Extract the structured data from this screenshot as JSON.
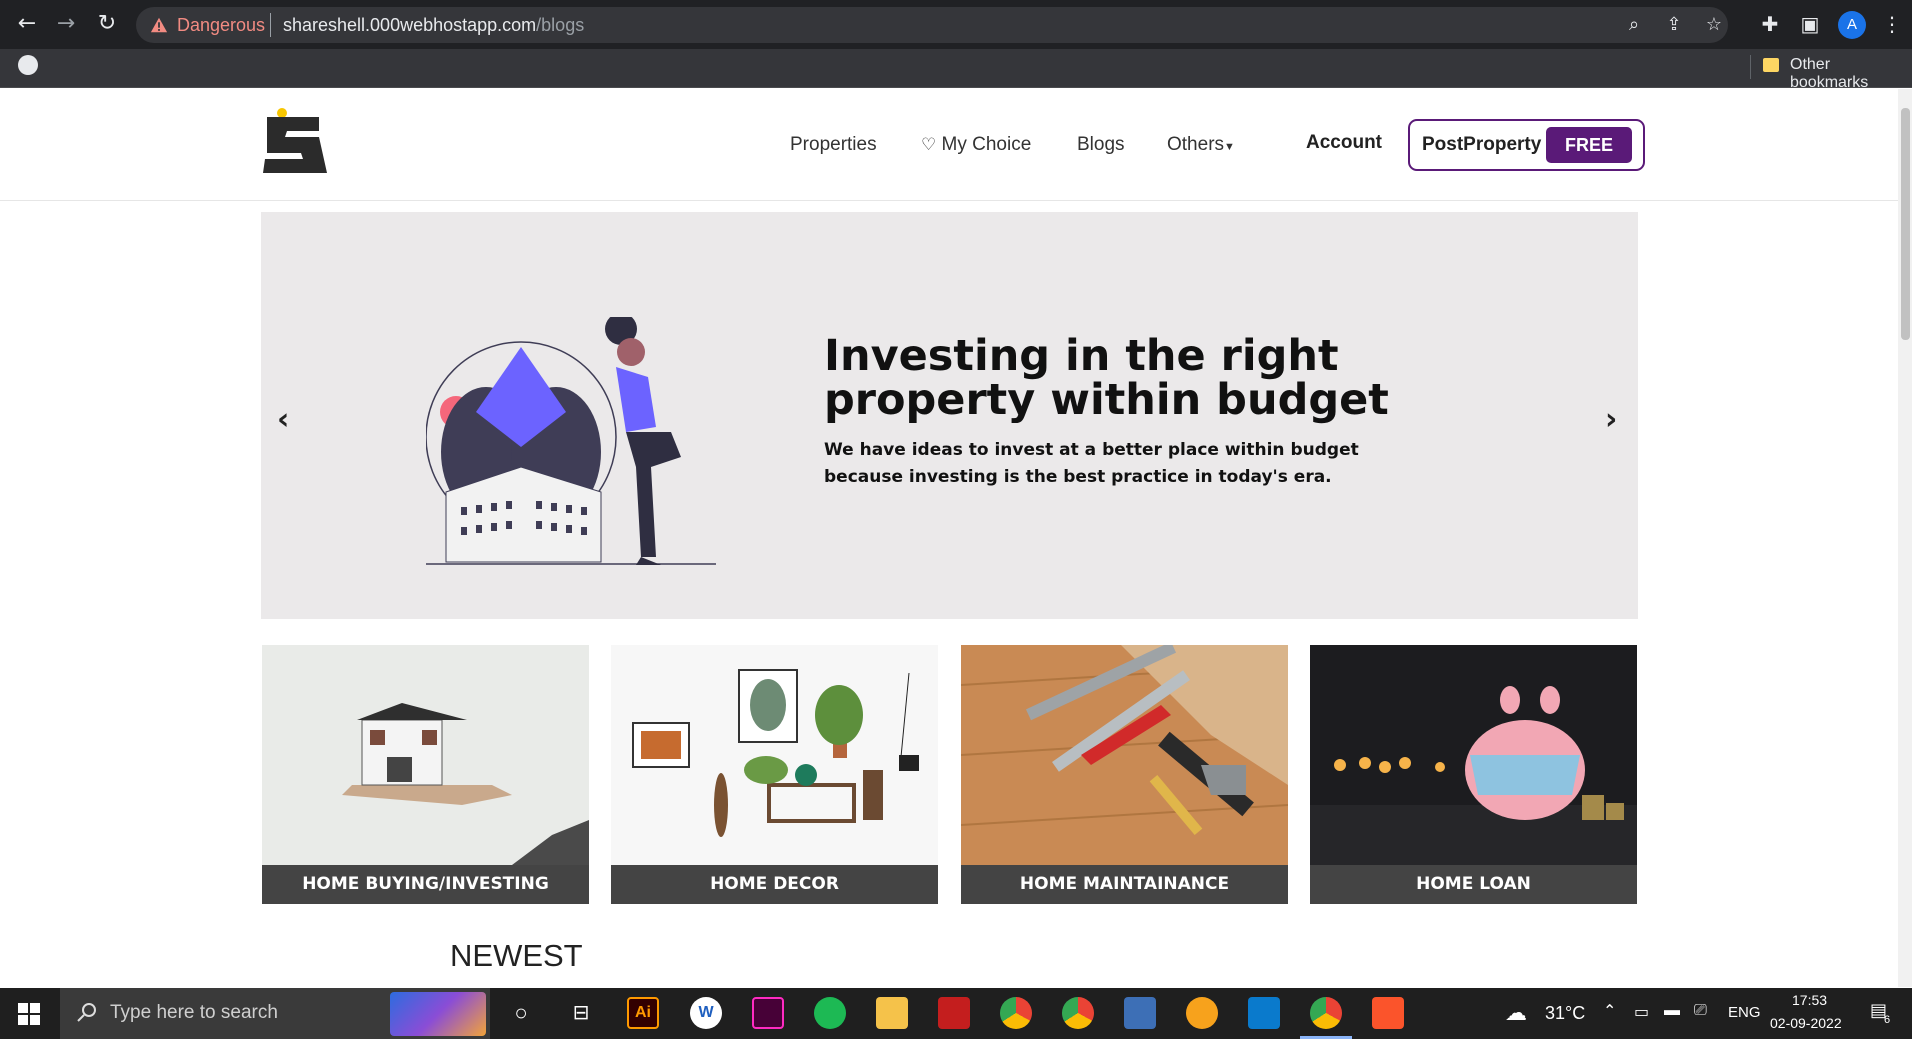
{
  "browser": {
    "security_label": "Dangerous",
    "url_host": "shareshell.000webhostapp.com",
    "url_path": "/blogs",
    "avatar_letter": "A",
    "bookmarks_label": "Other bookmarks"
  },
  "header": {
    "nav": [
      "Properties",
      "My Choice",
      "Blogs",
      "Others"
    ],
    "account": "Account",
    "post_label": "PostProperty",
    "free_label": "FREE"
  },
  "hero": {
    "title": "Investing in the right property within budget",
    "subtitle": "We have ideas to invest at a better place within budget because investing is the best practice in today's era.",
    "prev": "‹",
    "next": "›"
  },
  "categories": [
    {
      "label": "HOME BUYING/INVESTING"
    },
    {
      "label": "HOME DECOR"
    },
    {
      "label": "HOME MAINTAINANCE"
    },
    {
      "label": "HOME LOAN"
    }
  ],
  "section": {
    "newest": "NEWEST"
  },
  "taskbar": {
    "search_placeholder": "Type here to search",
    "weather": "31°C",
    "lang": "ENG",
    "time": "17:53",
    "date": "02-09-2022",
    "notif_count": "6",
    "app_ai": "Ai"
  },
  "colors": {
    "brand": "#5a1a78",
    "hero_bg": "#ebe9ea",
    "caption_bg": "#444444"
  }
}
